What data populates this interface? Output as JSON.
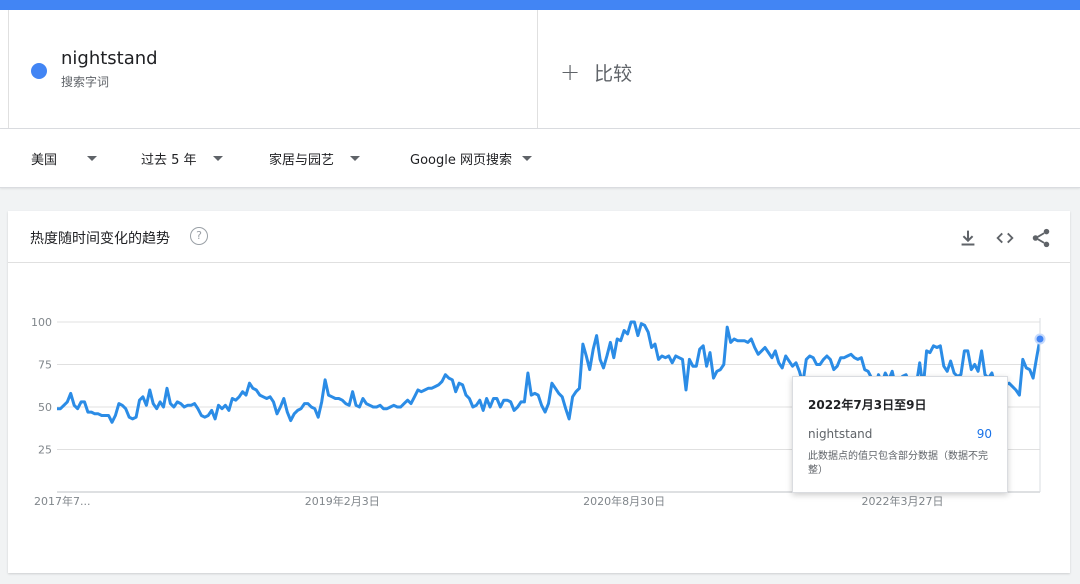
{
  "term": {
    "name": "nightstand",
    "subtitle": "搜索字词",
    "color": "#4285f4"
  },
  "compare": {
    "label": "比较"
  },
  "filters": [
    {
      "label": "美国"
    },
    {
      "label": "过去 5 年"
    },
    {
      "label": "家居与园艺"
    },
    {
      "label": "Google 网页搜索"
    }
  ],
  "card": {
    "title": "热度随时间变化的趋势",
    "help": "?"
  },
  "tooltip": {
    "date": "2022年7月3日至9日",
    "term": "nightstand",
    "value": "90",
    "note": "此数据点的值只包含部分数据（数据不完整）"
  },
  "chart_data": {
    "type": "line",
    "ylim": [
      0,
      100
    ],
    "y_ticks": [
      25,
      50,
      75,
      100
    ],
    "x_tick_labels": [
      "2017年7...",
      "2019年2月3日",
      "2020年8月30日",
      "2022年3月27日"
    ],
    "x_tick_positions": [
      0,
      83,
      165,
      246
    ],
    "line_color": "#2b8ce6",
    "series": [
      {
        "name": "nightstand",
        "values": [
          49,
          49,
          51,
          53,
          58,
          51,
          49,
          53,
          53,
          47,
          47,
          46,
          46,
          45,
          45,
          45,
          41,
          45,
          52,
          51,
          49,
          44,
          43,
          44,
          54,
          56,
          51,
          60,
          52,
          49,
          53,
          50,
          61,
          52,
          50,
          53,
          52,
          50,
          51,
          51,
          52,
          49,
          45,
          44,
          45,
          48,
          43,
          51,
          49,
          51,
          48,
          55,
          54,
          56,
          59,
          57,
          64,
          61,
          60,
          57,
          56,
          55,
          56,
          53,
          46,
          50,
          55,
          47,
          42,
          46,
          48,
          49,
          52,
          52,
          50,
          49,
          44,
          53,
          66,
          57,
          56,
          55,
          55,
          54,
          52,
          51,
          59,
          51,
          50,
          55,
          52,
          51,
          50,
          50,
          51,
          49,
          49,
          50,
          51,
          50,
          50,
          52,
          54,
          52,
          56,
          60,
          59,
          60,
          61,
          61,
          62,
          63,
          65,
          69,
          67,
          66,
          59,
          64,
          63,
          57,
          55,
          50,
          51,
          54,
          48,
          55,
          50,
          55,
          55,
          50,
          54,
          54,
          53,
          48,
          50,
          53,
          53,
          70,
          57,
          58,
          57,
          51,
          47,
          52,
          64,
          61,
          58,
          56,
          49,
          43,
          56,
          59,
          61,
          87,
          80,
          72,
          84,
          92,
          78,
          73,
          80,
          88,
          79,
          90,
          89,
          95,
          93,
          100,
          100,
          92,
          99,
          98,
          94,
          85,
          87,
          78,
          80,
          79,
          80,
          76,
          80,
          79,
          78,
          60,
          78,
          74,
          74,
          84,
          86,
          74,
          82,
          67,
          71,
          72,
          75,
          97,
          88,
          90,
          89,
          89,
          89,
          88,
          90,
          85,
          81,
          83,
          85,
          82,
          79,
          83,
          76,
          73,
          80,
          77,
          74,
          76,
          71,
          64,
          78,
          80,
          79,
          75,
          75,
          78,
          80,
          78,
          72,
          74,
          79,
          79,
          80,
          81,
          79,
          78,
          79,
          72,
          71,
          67,
          62,
          69,
          64,
          70,
          66,
          71,
          62,
          66,
          68,
          69,
          64,
          67,
          63,
          76,
          61,
          83,
          82,
          86,
          85,
          86,
          74,
          71,
          77,
          70,
          68,
          69,
          83,
          83,
          72,
          75,
          71,
          83,
          69,
          67,
          70,
          62,
          66,
          62,
          63,
          64,
          62,
          60,
          57,
          78,
          73,
          72,
          67,
          79,
          90
        ]
      }
    ]
  }
}
